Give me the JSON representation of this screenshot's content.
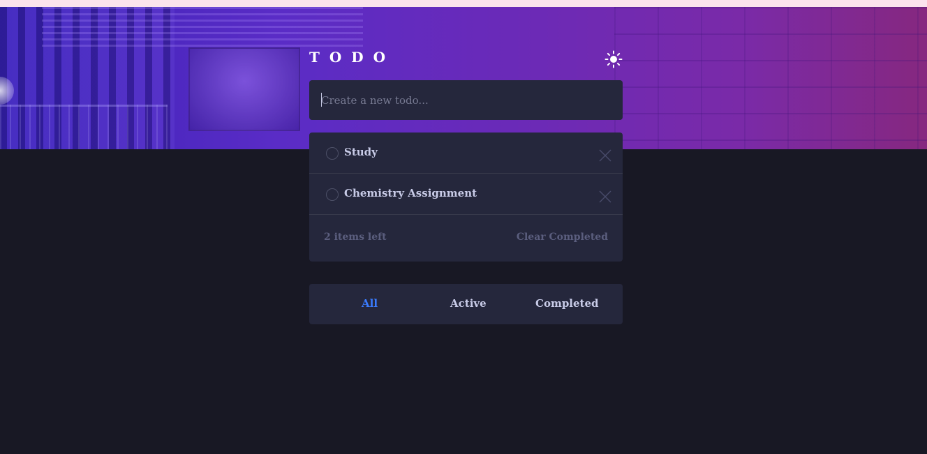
{
  "app": {
    "title": "TODO"
  },
  "icons": {
    "theme_toggle": "sun-icon",
    "delete": "cross-icon",
    "check": "circle-icon"
  },
  "colors": {
    "background": "#181824",
    "card": "#25273c",
    "accent": "#3a7bfd",
    "text": "#c8cbe7",
    "muted": "#5b5e7e"
  },
  "new_todo": {
    "placeholder": "Create a new todo...",
    "value": ""
  },
  "todos": [
    {
      "text": "Study",
      "completed": false
    },
    {
      "text": "Chemistry Assignment",
      "completed": false
    }
  ],
  "footer": {
    "items_left": "2 items left",
    "clear_label": "Clear Completed"
  },
  "filters": [
    {
      "label": "All",
      "active": true
    },
    {
      "label": "Active",
      "active": false
    },
    {
      "label": "Completed",
      "active": false
    }
  ]
}
